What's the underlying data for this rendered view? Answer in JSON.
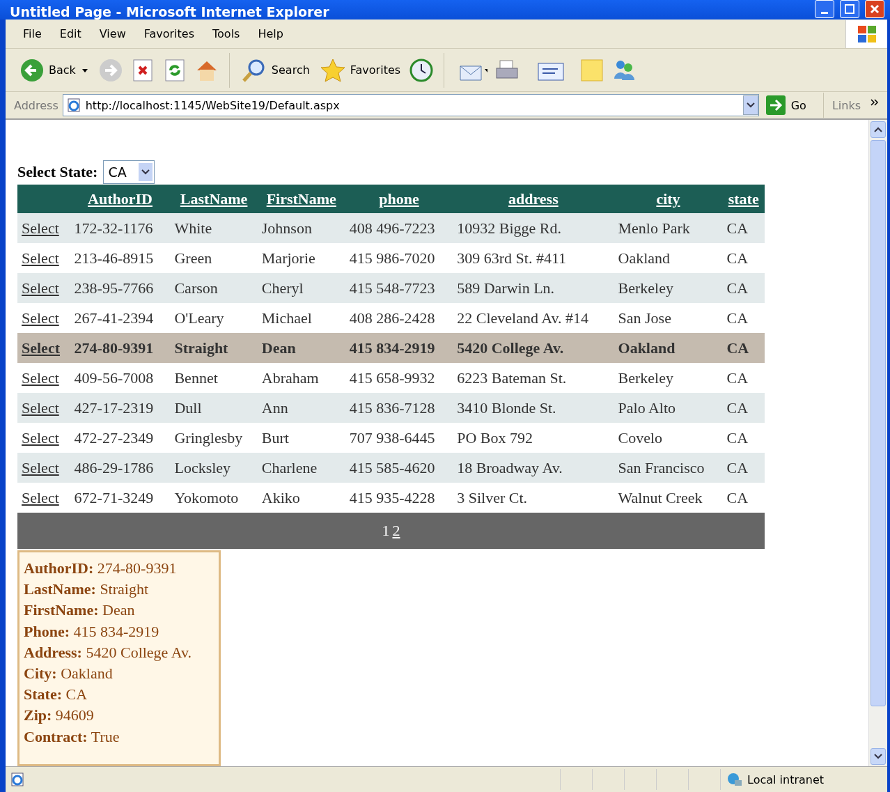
{
  "window": {
    "title": "Untitled Page - Microsoft Internet Explorer"
  },
  "menu": [
    "File",
    "Edit",
    "View",
    "Favorites",
    "Tools",
    "Help"
  ],
  "toolbar": {
    "back": "Back",
    "search": "Search",
    "favorites": "Favorites"
  },
  "address_bar": {
    "label": "Address",
    "url": "http://localhost:1145/WebSite19/Default.aspx",
    "go": "Go",
    "links": "Links"
  },
  "state_filter": {
    "label": "Select State:",
    "value": "CA"
  },
  "table": {
    "columns": [
      "AuthorID",
      "LastName",
      "FirstName",
      "phone",
      "address",
      "city",
      "state"
    ],
    "rows": [
      {
        "action": "Select",
        "cells": [
          "172-32-1176",
          "White",
          "Johnson",
          "408 496-7223",
          "10932 Bigge Rd.",
          "Menlo Park",
          "CA"
        ],
        "selected": false
      },
      {
        "action": "Select",
        "cells": [
          "213-46-8915",
          "Green",
          "Marjorie",
          "415 986-7020",
          "309 63rd St. #411",
          "Oakland",
          "CA"
        ],
        "selected": false
      },
      {
        "action": "Select",
        "cells": [
          "238-95-7766",
          "Carson",
          "Cheryl",
          "415 548-7723",
          "589 Darwin Ln.",
          "Berkeley",
          "CA"
        ],
        "selected": false
      },
      {
        "action": "Select",
        "cells": [
          "267-41-2394",
          "O'Leary",
          "Michael",
          "408 286-2428",
          "22 Cleveland Av. #14",
          "San Jose",
          "CA"
        ],
        "selected": false
      },
      {
        "action": "Select",
        "cells": [
          "274-80-9391",
          "Straight",
          "Dean",
          "415 834-2919",
          "5420 College Av.",
          "Oakland",
          "CA"
        ],
        "selected": true
      },
      {
        "action": "Select",
        "cells": [
          "409-56-7008",
          "Bennet",
          "Abraham",
          "415 658-9932",
          "6223 Bateman St.",
          "Berkeley",
          "CA"
        ],
        "selected": false
      },
      {
        "action": "Select",
        "cells": [
          "427-17-2319",
          "Dull",
          "Ann",
          "415 836-7128",
          "3410 Blonde St.",
          "Palo Alto",
          "CA"
        ],
        "selected": false
      },
      {
        "action": "Select",
        "cells": [
          "472-27-2349",
          "Gringlesby",
          "Burt",
          "707 938-6445",
          "PO Box 792",
          "Covelo",
          "CA"
        ],
        "selected": false
      },
      {
        "action": "Select",
        "cells": [
          "486-29-1786",
          "Locksley",
          "Charlene",
          "415 585-4620",
          "18 Broadway Av.",
          "San Francisco",
          "CA"
        ],
        "selected": false
      },
      {
        "action": "Select",
        "cells": [
          "672-71-3249",
          "Yokomoto",
          "Akiko",
          "415 935-4228",
          "3 Silver Ct.",
          "Walnut Creek",
          "CA"
        ],
        "selected": false
      }
    ],
    "pages": [
      {
        "label": "1",
        "selected": true
      },
      {
        "label": "2",
        "selected": false
      }
    ]
  },
  "details": [
    {
      "label": "AuthorID:",
      "value": "274-80-9391"
    },
    {
      "label": "LastName:",
      "value": "Straight"
    },
    {
      "label": "FirstName:",
      "value": "Dean"
    },
    {
      "label": "Phone:",
      "value": "415 834-2919"
    },
    {
      "label": "Address:",
      "value": "5420 College Av."
    },
    {
      "label": "City:",
      "value": "Oakland"
    },
    {
      "label": "State:",
      "value": "CA"
    },
    {
      "label": "Zip:",
      "value": "94609"
    },
    {
      "label": "Contract:",
      "value": "True"
    }
  ],
  "status_bar": {
    "zone": "Local intranet"
  }
}
